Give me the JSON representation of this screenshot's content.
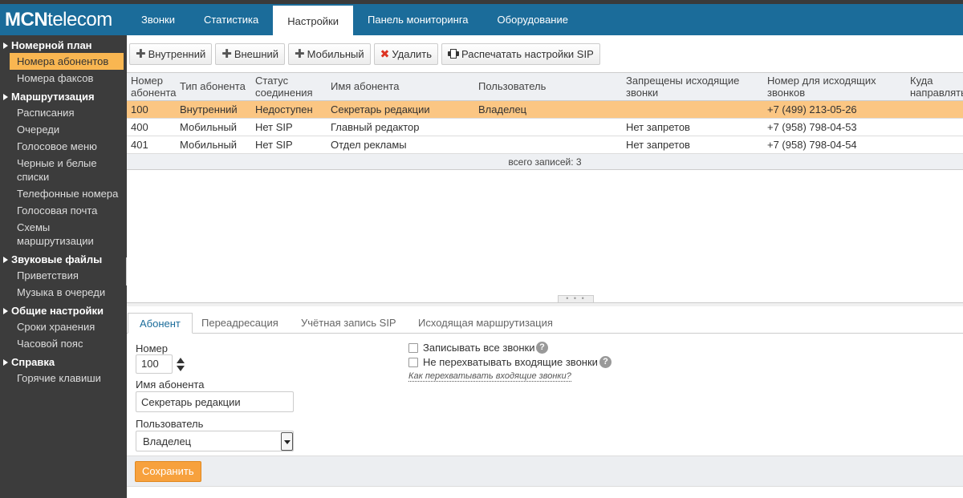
{
  "app": {
    "logo_bold": "MCN",
    "logo_rest": "telecom"
  },
  "nav": {
    "tabs": [
      "Звонки",
      "Статистика",
      "Настройки",
      "Панель мониторинга",
      "Оборудование"
    ],
    "active": "Настройки"
  },
  "sidebar": {
    "groups": [
      {
        "title": "Номерной план",
        "items": [
          "Номера абонентов",
          "Номера факсов"
        ]
      },
      {
        "title": "Маршрутизация",
        "items": [
          "Расписания",
          "Очереди",
          "Голосовое меню",
          "Черные и белые списки",
          "Телефонные номера",
          "Голосовая почта",
          "Схемы маршрутизации"
        ]
      },
      {
        "title": "Звуковые файлы",
        "items": [
          "Приветствия",
          "Музыка в очереди"
        ]
      },
      {
        "title": "Общие настройки",
        "items": [
          "Сроки хранения",
          "Часовой пояс"
        ]
      },
      {
        "title": "Справка",
        "items": [
          "Горячие клавиши"
        ]
      }
    ],
    "active_item": "Номера абонентов"
  },
  "toolbar": {
    "internal": "Внутренний",
    "external": "Внешний",
    "mobile": "Мобильный",
    "delete": "Удалить",
    "print_sip": "Распечатать настройки SIP"
  },
  "grid": {
    "columns": [
      "Номер абонента",
      "Тип абонента",
      "Статус соединения",
      "Имя абонента",
      "Пользователь",
      "Запрещены исходящие звонки",
      "Номер для исходящих звонков",
      "Куда направлять звонок"
    ],
    "rows": [
      [
        "100",
        "Внутренний",
        "Недоступен",
        "Секретарь редакции",
        "Владелец",
        "",
        "+7 (499) 213-05-26",
        ""
      ],
      [
        "400",
        "Мобильный",
        "Нет SIP",
        "Главный редактор",
        "",
        "Нет запретов",
        "+7 (958) 798-04-53",
        ""
      ],
      [
        "401",
        "Мобильный",
        "Нет SIP",
        "Отдел рекламы",
        "",
        "Нет запретов",
        "+7 (958) 798-04-54",
        ""
      ]
    ],
    "selected_row": 0,
    "footer": "всего записей: 3"
  },
  "form_tabs": [
    "Абонент",
    "Переадресация",
    "Учётная запись SIP",
    "Исходящая маршрутизация"
  ],
  "form": {
    "number_label": "Номер",
    "number_value": "100",
    "name_label": "Имя абонента",
    "name_value": "Секретарь редакции",
    "user_label": "Пользователь",
    "user_value": "Владелец",
    "record_all": "Записывать все звонки",
    "no_intercept": "Не перехватывать входящие звонки",
    "intercept_link": "Как перехватывать входящие звонки?",
    "help_glyph": "?",
    "save": "Сохранить"
  },
  "colors": {
    "header": "#1b6c9a",
    "sidebar": "#3c3c3c",
    "active_sidebar": "#f9b651",
    "selected_row": "#fbc683",
    "save_button": "#f7a13d"
  }
}
